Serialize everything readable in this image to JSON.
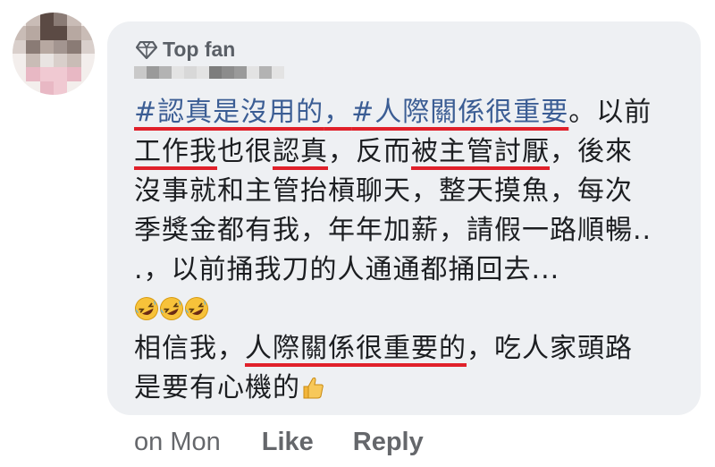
{
  "comment": {
    "badge_label": "Top fan",
    "badge_icon": "diamond-icon",
    "hashtag_1": "#認真是沒用的",
    "hashtag_sep": "，",
    "hashtag_2": "#人際關係很重要",
    "line1_tail": "。以前",
    "line2_u1": "工作我",
    "line2_mid1": "也很",
    "line2_u2": "認真",
    "line2_mid2": "，反而",
    "line2_u3": "被主管討厭",
    "line2_tail": "，後來",
    "line3": "沒事就和主管抬槓聊天，整天摸魚，每次",
    "line4": "季獎金都有我，年年加薪，請假一路順暢..",
    "line5": ".，以前捅我刀的人通通都捅回去...",
    "emoji_row": [
      "rolling-on-floor-laughing-emoji",
      "rolling-on-floor-laughing-emoji",
      "rolling-on-floor-laughing-emoji"
    ],
    "line7_head": "相信我，",
    "line7_u": "人際關係很重要的",
    "line7_tail": "，吃人家頭路",
    "line8": "是要有心機的",
    "line8_emoji": "thumbs-up-emoji"
  },
  "actions": {
    "time": "on Mon",
    "like_label": "Like",
    "reply_label": "Reply"
  },
  "colors": {
    "bubble_bg": "#eef0f3",
    "hashtag": "#3b5d94",
    "underline": "#e0202a",
    "meta_text": "#65676b"
  }
}
